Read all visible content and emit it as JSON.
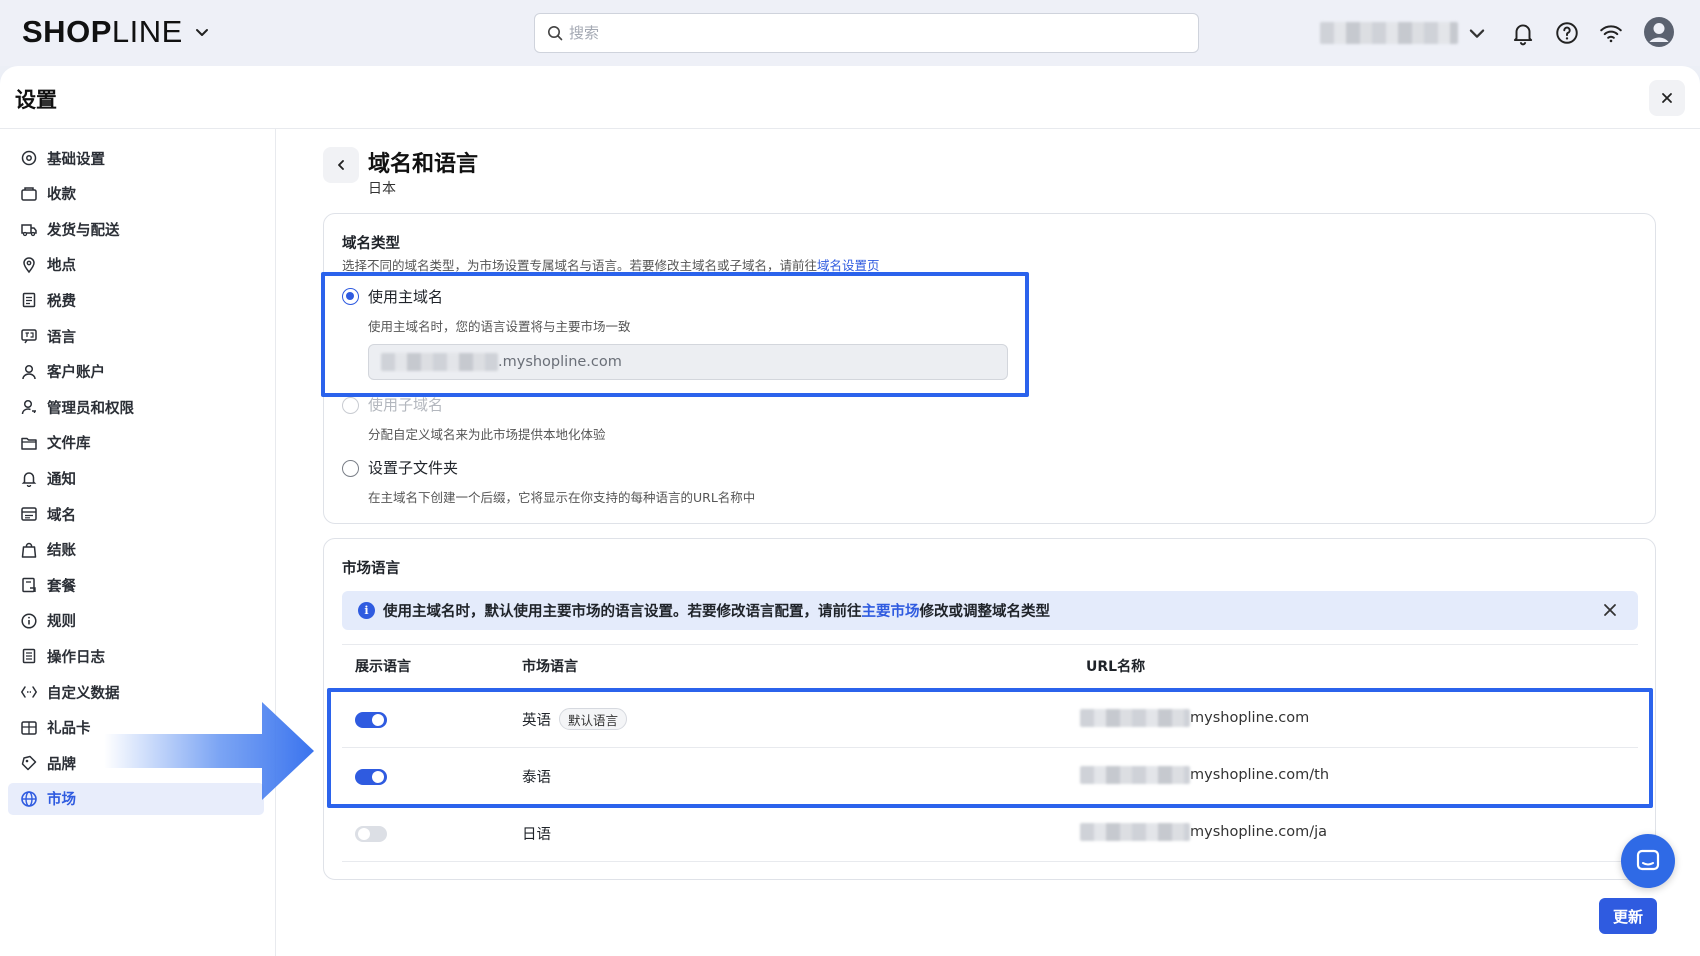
{
  "topbar": {
    "logo_bold": "SH",
    "logo_o": "O",
    "logo_p": "P",
    "logo_light": "LINE",
    "search_placeholder": "搜索"
  },
  "panel": {
    "title": "设置"
  },
  "sidebar": {
    "items": [
      {
        "label": "基础设置",
        "icon": "gear-icon"
      },
      {
        "label": "收款",
        "icon": "wallet-icon"
      },
      {
        "label": "发货与配送",
        "icon": "truck-icon"
      },
      {
        "label": "地点",
        "icon": "location-icon"
      },
      {
        "label": "税费",
        "icon": "receipt-icon"
      },
      {
        "label": "语言",
        "icon": "language-icon"
      },
      {
        "label": "客户账户",
        "icon": "user-icon"
      },
      {
        "label": "管理员和权限",
        "icon": "user-key-icon"
      },
      {
        "label": "文件库",
        "icon": "folder-icon"
      },
      {
        "label": "通知",
        "icon": "bell-icon"
      },
      {
        "label": "域名",
        "icon": "domain-icon"
      },
      {
        "label": "结账",
        "icon": "bag-icon"
      },
      {
        "label": "套餐",
        "icon": "plan-icon"
      },
      {
        "label": "规则",
        "icon": "info-icon"
      },
      {
        "label": "操作日志",
        "icon": "log-icon"
      },
      {
        "label": "自定义数据",
        "icon": "code-icon"
      },
      {
        "label": "礼品卡",
        "icon": "gift-card-icon"
      },
      {
        "label": "品牌",
        "icon": "brand-icon"
      },
      {
        "label": "市场",
        "icon": "globe-icon",
        "active": true
      }
    ]
  },
  "header": {
    "title": "域名和语言",
    "subtitle": "日本"
  },
  "domain_type": {
    "label": "域名类型",
    "desc_prefix": "选择不同的域名类型，为市场设置专属域名与语言。若要修改主域名或子域名，请前往",
    "desc_link": "域名设置页",
    "options": [
      {
        "label": "使用主域名",
        "desc": "使用主域名时，您的语言设置将与主要市场一致",
        "selected": true
      },
      {
        "label": "使用子域名",
        "desc": "分配自定义域名来为此市场提供本地化体验",
        "disabled": true
      },
      {
        "label": "设置子文件夹",
        "desc": "在主域名下创建一个后缀，它将显示在你支持的每种语言的URL名称中"
      }
    ],
    "domain_suffix": ".myshopline.com"
  },
  "market_language": {
    "label": "市场语言",
    "notice_prefix": "使用主域名时，默认使用主要市场的语言设置。若要修改语言配置，请前往",
    "notice_link": "主要市场",
    "notice_suffix": "修改或调整域名类型",
    "columns": [
      "展示语言",
      "市场语言",
      "URL名称"
    ],
    "rows": [
      {
        "enabled": true,
        "language": "英语",
        "badge": "默认语言",
        "url_suffix": "myshopline.com"
      },
      {
        "enabled": true,
        "language": "泰语",
        "badge": "",
        "url_suffix": "myshopline.com/th"
      },
      {
        "enabled": false,
        "language": "日语",
        "badge": "",
        "url_suffix": "myshopline.com/ja"
      }
    ]
  },
  "actions": {
    "update_label": "更新"
  },
  "colors": {
    "accent": "#2f5be0",
    "highlight": "#2b63ec",
    "notice_bg": "#e4ebfb"
  }
}
